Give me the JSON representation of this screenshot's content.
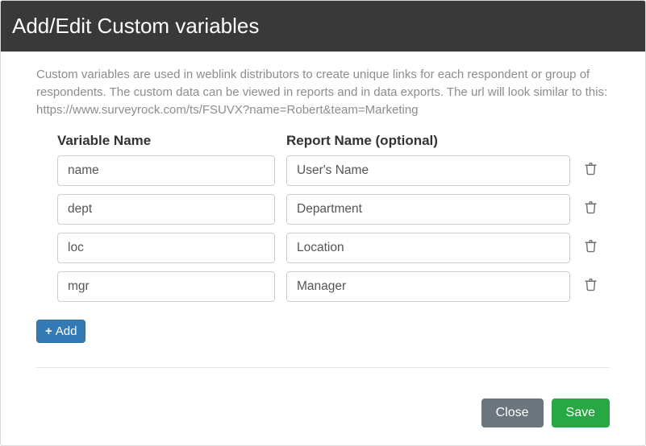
{
  "header": {
    "title": "Add/Edit Custom variables"
  },
  "intro": "Custom variables are used in weblink distributors to create unique links for each respondent or group of respondents. The custom data can be viewed in reports and in data exports. The url will look similar to this: https://www.surveyrock.com/ts/FSUVX?name=Robert&team=Marketing",
  "columns": {
    "variable": "Variable Name",
    "report": "Report Name (optional)"
  },
  "rows": [
    {
      "variable": "name",
      "report": "User's Name"
    },
    {
      "variable": "dept",
      "report": "Department"
    },
    {
      "variable": "loc",
      "report": "Location"
    },
    {
      "variable": "mgr",
      "report": "Manager"
    }
  ],
  "buttons": {
    "add": "Add",
    "close": "Close",
    "save": "Save"
  }
}
